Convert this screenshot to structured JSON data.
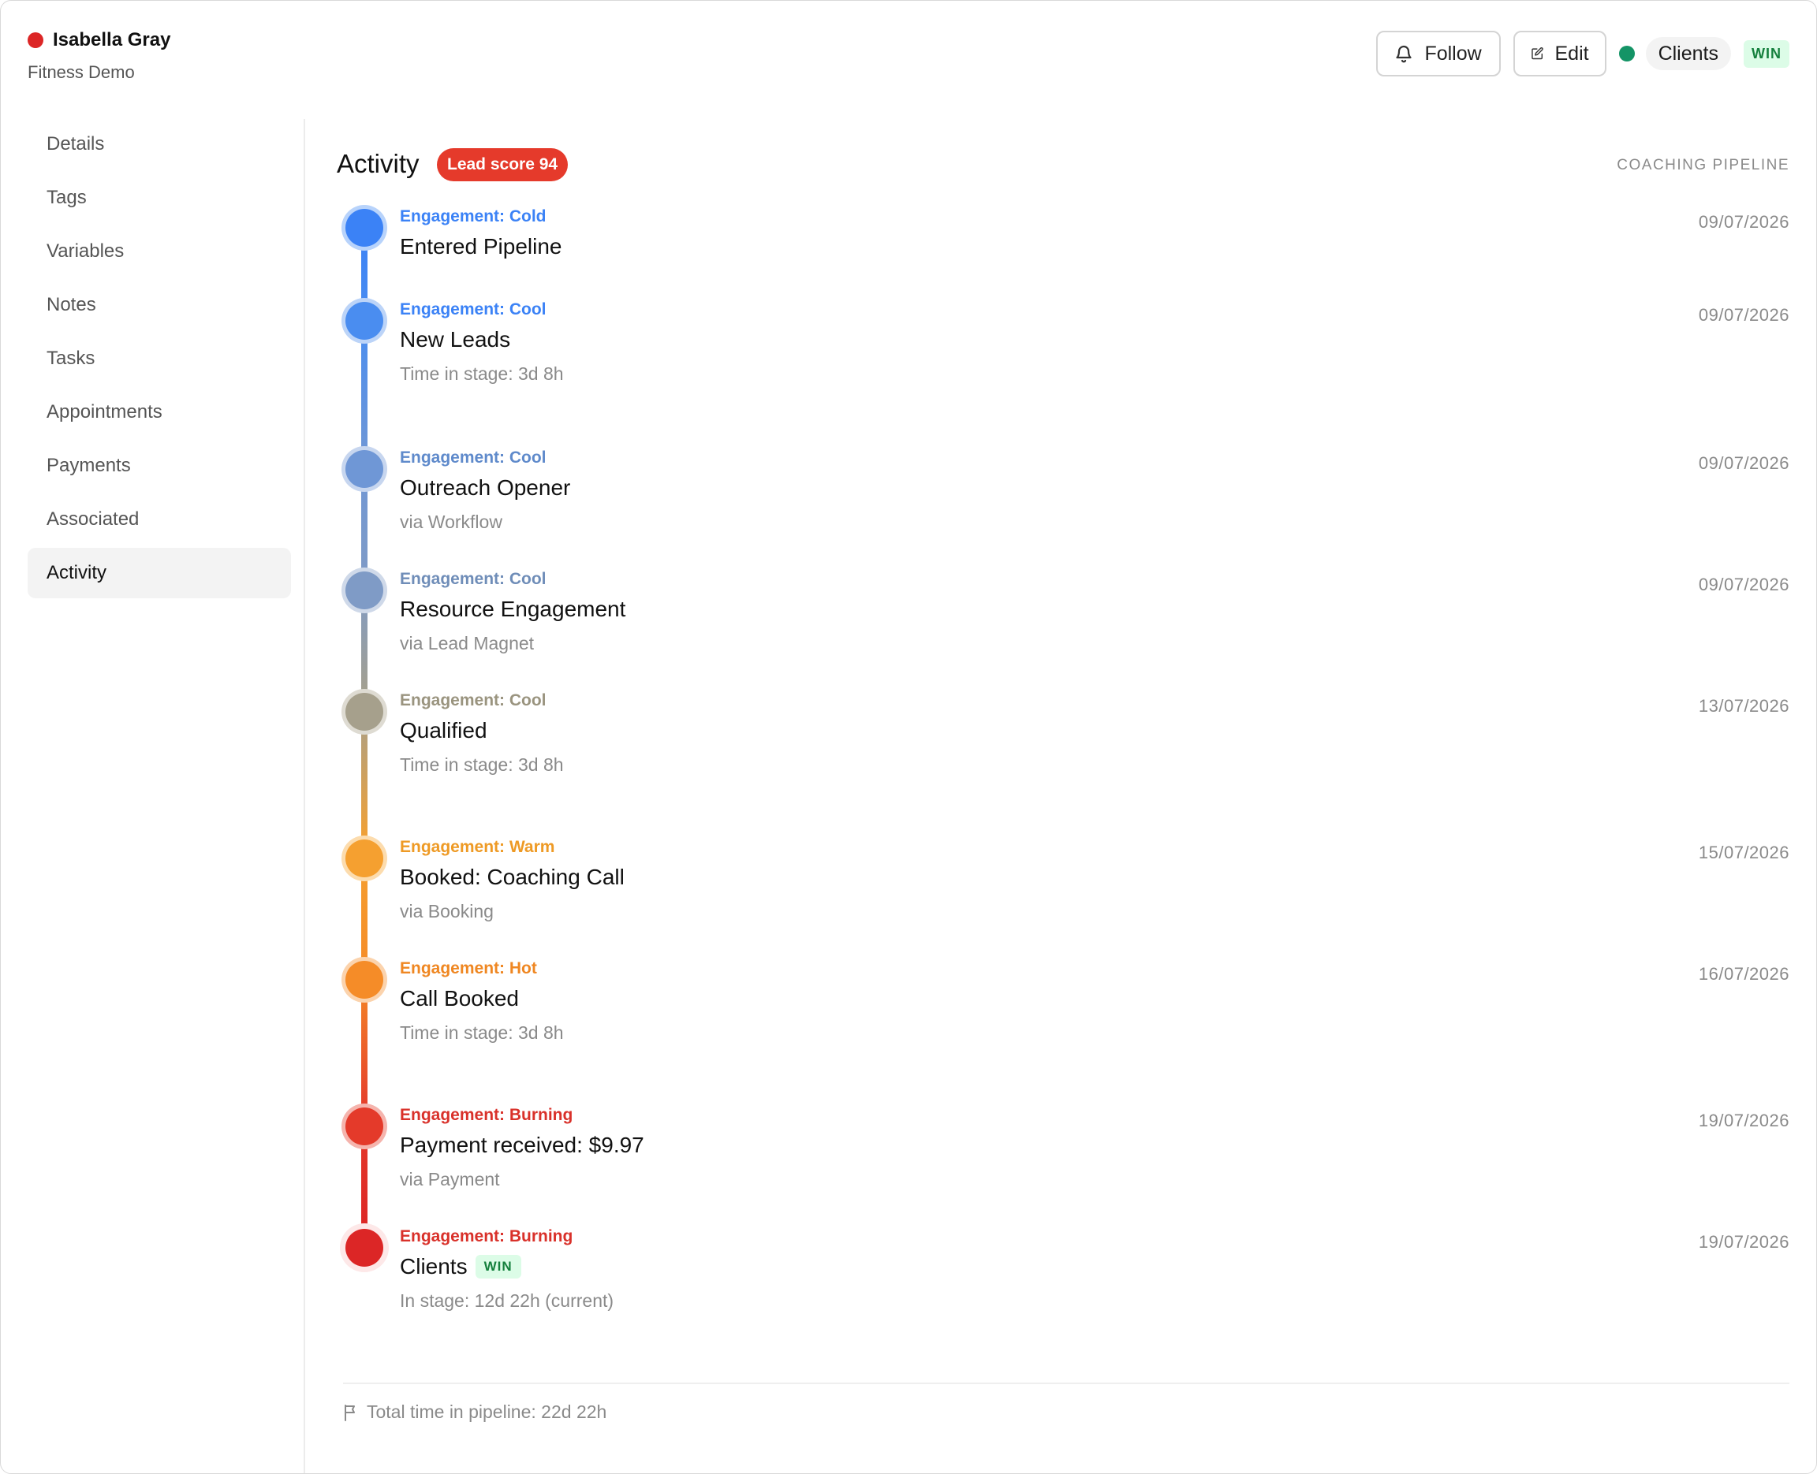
{
  "contact": {
    "name": "Isabella Gray",
    "subtitle": "Fitness Demo",
    "status_color": "#dc2626"
  },
  "toolbar": {
    "follow_label": "Follow",
    "edit_label": "Edit",
    "stage_label": "Clients",
    "stage_color": "#149466",
    "stage_badge": "WIN"
  },
  "sidebar": {
    "items": [
      {
        "label": "Details"
      },
      {
        "label": "Tags"
      },
      {
        "label": "Variables"
      },
      {
        "label": "Notes"
      },
      {
        "label": "Tasks"
      },
      {
        "label": "Appointments"
      },
      {
        "label": "Payments"
      },
      {
        "label": "Associated"
      },
      {
        "label": "Activity",
        "active": true
      }
    ]
  },
  "main": {
    "title": "Activity",
    "lead_badge": "Lead score 94",
    "pipeline_label": "COACHING PIPELINE",
    "events": [
      {
        "engagement": "Engagement: Cold",
        "title": "Entered Pipeline",
        "sub": "",
        "date": "09/07/2026",
        "color": "#3b82f6"
      },
      {
        "engagement": "Engagement: Cool",
        "title": "New Leads",
        "sub": "Time in stage: 3d 8h",
        "date": "09/07/2026",
        "color": "#4a8df0"
      },
      {
        "engagement": "Engagement: Cool",
        "title": "Outreach Opener",
        "sub": "via Workflow",
        "date": "09/07/2026",
        "color": "#6f97d6"
      },
      {
        "engagement": "Engagement: Cool",
        "title": "Resource Engagement",
        "sub": "via Lead Magnet",
        "date": "09/07/2026",
        "color": "#7f9bc6"
      },
      {
        "engagement": "Engagement: Cool",
        "title": "Qualified",
        "sub": "Time in stage: 3d 8h",
        "date": "13/07/2026",
        "color": "#a6a08c"
      },
      {
        "engagement": "Engagement: Warm",
        "title": "Booked: Coaching Call",
        "sub": "via Booking",
        "date": "15/07/2026",
        "color": "#f5a030"
      },
      {
        "engagement": "Engagement: Hot",
        "title": "Call Booked",
        "sub": "Time in stage: 3d 8h",
        "date": "16/07/2026",
        "color": "#f58c28"
      },
      {
        "engagement": "Engagement: Burning",
        "title": "Payment received: $9.97",
        "sub": "via Payment",
        "date": "19/07/2026",
        "color": "#e43a2a"
      },
      {
        "engagement": "Engagement: Burning",
        "title": "Clients",
        "badge": "WIN",
        "sub": "In stage: 12d 22h (current)",
        "date": "19/07/2026",
        "color": "#dc2626"
      }
    ],
    "footer": "Total time in pipeline: 22d 22h"
  }
}
